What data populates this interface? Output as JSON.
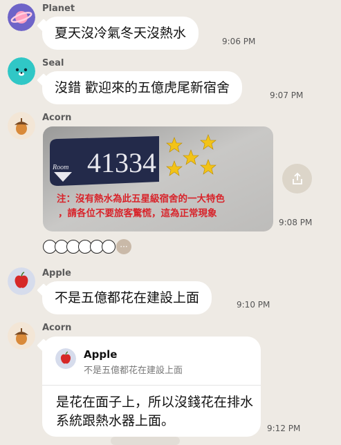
{
  "messages": [
    {
      "sender": "Planet",
      "avatar_icon": "planet-icon",
      "text": "夏天沒冷氣冬天沒熱水",
      "time": "9:06 PM"
    },
    {
      "sender": "Seal",
      "avatar_icon": "seal-icon",
      "text": "沒錯 歡迎來的五億虎尾新宿舍",
      "time": "9:07 PM"
    },
    {
      "sender": "Acorn",
      "avatar_icon": "acorn-icon",
      "type": "image",
      "time": "9:08 PM",
      "image": {
        "room_label": "Room",
        "room_number": "41334",
        "caption_line1": "注：沒有熱水為此五星級宿舍的一大特色",
        "caption_line2": "，請各位不要旅客驚慌，這為正常現象"
      }
    },
    {
      "sender": "Apple",
      "avatar_icon": "apple-icon",
      "text": "不是五億都花在建設上面",
      "time": "9:10 PM"
    },
    {
      "sender": "Acorn",
      "avatar_icon": "acorn-icon",
      "type": "reply",
      "time": "9:12 PM",
      "reply_to": {
        "sender": "Apple",
        "text": "不是五億都花在建設上面"
      },
      "text": "是花在面子上，所以沒錢花在排水系統跟熱水器上面。"
    }
  ],
  "reactions": {
    "more_label": "···"
  },
  "colors": {
    "background": "#eeeae4",
    "bubble": "#ffffff",
    "star": "#f2c318",
    "caption_red": "#d8232a",
    "plate": "#232a4a"
  }
}
